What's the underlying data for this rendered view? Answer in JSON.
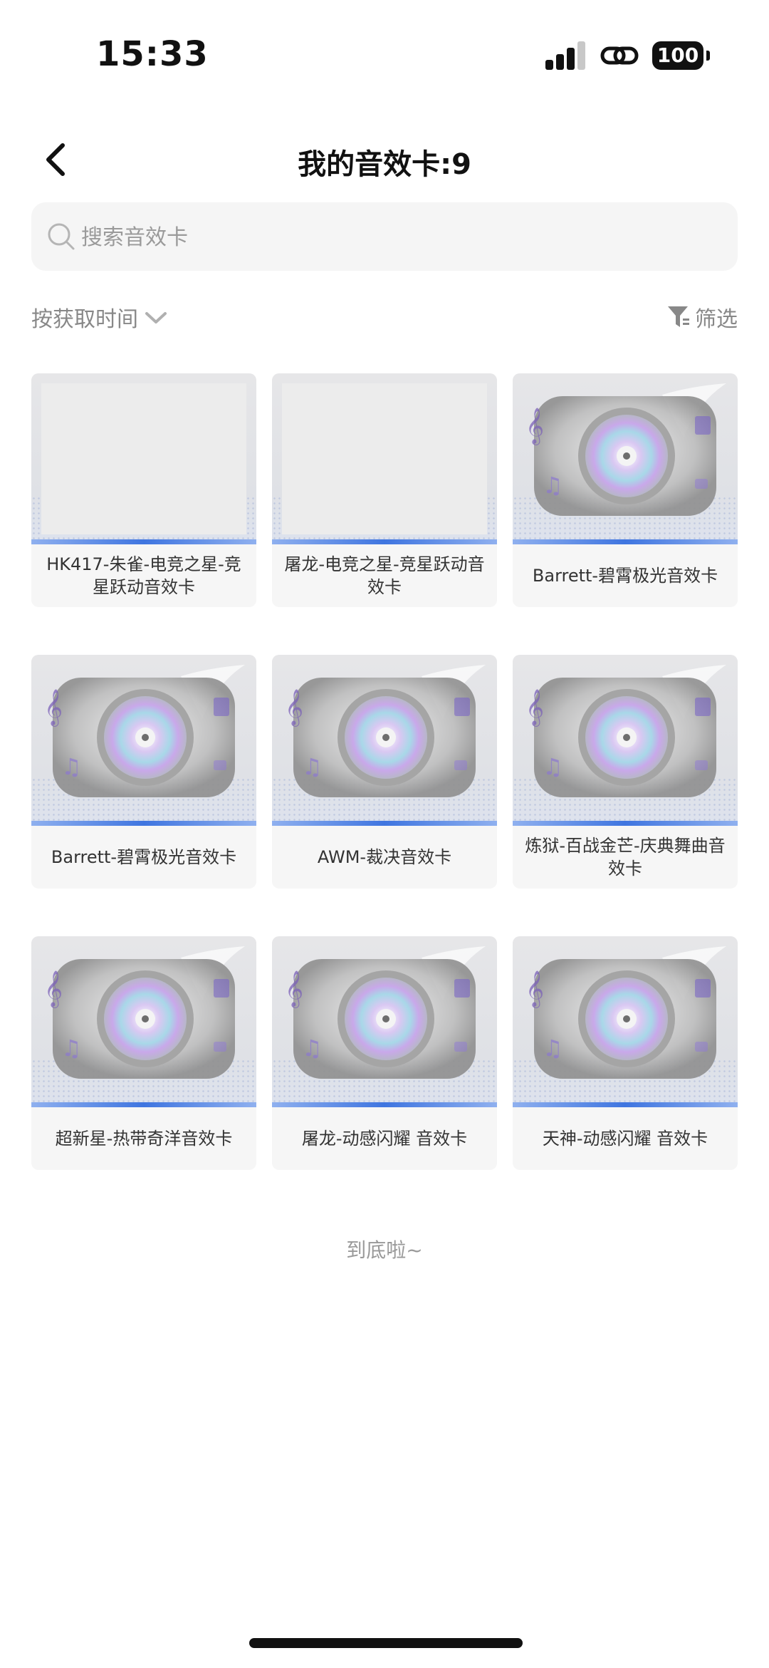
{
  "status_bar": {
    "time": "15:33",
    "battery": "100"
  },
  "header": {
    "title": "我的音效卡:9"
  },
  "search": {
    "placeholder": "搜索音效卡"
  },
  "filters": {
    "sort_label": "按获取时间",
    "filter_label": "筛选"
  },
  "cards": [
    {
      "title": "HK417-朱雀-电竞之星-竞星跃动音效卡",
      "image": "blank"
    },
    {
      "title": "屠龙-电竞之星-竞星跃动音效卡",
      "image": "blank"
    },
    {
      "title": "Barrett-碧霄极光音效卡",
      "image": "vinyl-icon"
    },
    {
      "title": "Barrett-碧霄极光音效卡",
      "image": "vinyl-icon"
    },
    {
      "title": "AWM-裁决音效卡",
      "image": "vinyl-icon"
    },
    {
      "title": "炼狱-百战金芒-庆典舞曲音效卡",
      "image": "vinyl-icon"
    },
    {
      "title": "超新星-热带奇洋音效卡",
      "image": "vinyl-icon"
    },
    {
      "title": "屠龙-动感闪耀 音效卡",
      "image": "vinyl-icon"
    },
    {
      "title": "天神-动感闪耀 音效卡",
      "image": "vinyl-icon"
    }
  ],
  "footer": {
    "end_text": "到底啦~"
  },
  "colors": {
    "accent": "#3f75e0",
    "muted_text": "#888888",
    "card_bg": "#f6f6f6"
  }
}
